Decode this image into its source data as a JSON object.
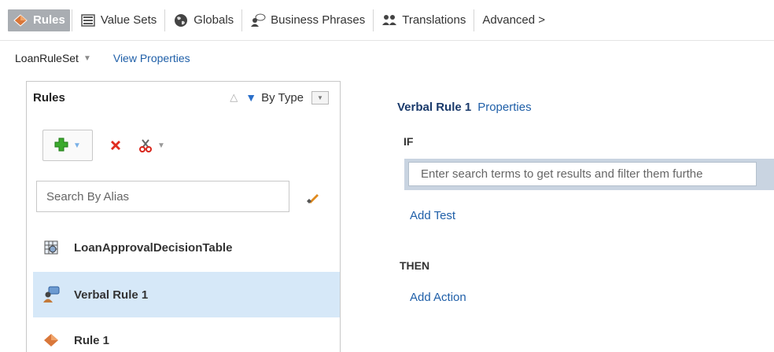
{
  "tabs": [
    {
      "label": "Rules",
      "icon": "rules-icon",
      "active": true
    },
    {
      "label": "Value Sets",
      "icon": "value-sets-icon",
      "active": false
    },
    {
      "label": "Globals",
      "icon": "globe-icon",
      "active": false
    },
    {
      "label": "Business Phrases",
      "icon": "business-phrases-icon",
      "active": false
    },
    {
      "label": "Translations",
      "icon": "translations-icon",
      "active": false
    },
    {
      "label": "Advanced >",
      "icon": null,
      "active": false
    }
  ],
  "ruleset": {
    "name": "LoanRuleSet",
    "view_properties": "View Properties"
  },
  "rules_panel": {
    "title": "Rules",
    "sort_label": "By Type",
    "search_placeholder": "Search By Alias",
    "items": [
      {
        "label": "LoanApprovalDecisionTable",
        "icon": "decision-table-icon",
        "selected": false
      },
      {
        "label": "Verbal Rule 1",
        "icon": "verbal-rule-icon",
        "selected": true
      },
      {
        "label": "Rule 1",
        "icon": "rule-diamond-icon",
        "selected": false
      }
    ]
  },
  "editor": {
    "rule_name": "Verbal Rule 1",
    "properties_link": "Properties",
    "if_label": "IF",
    "condition_placeholder": "Enter search terms to get results and filter them furthe",
    "add_test": "Add Test",
    "then_label": "THEN",
    "add_action": "Add Action"
  },
  "colors": {
    "active_tab_bg": "#a9adb2",
    "link": "#1f5fa8",
    "selected_row": "#d6e8f8",
    "condition_bar": "#c9d4e1"
  }
}
